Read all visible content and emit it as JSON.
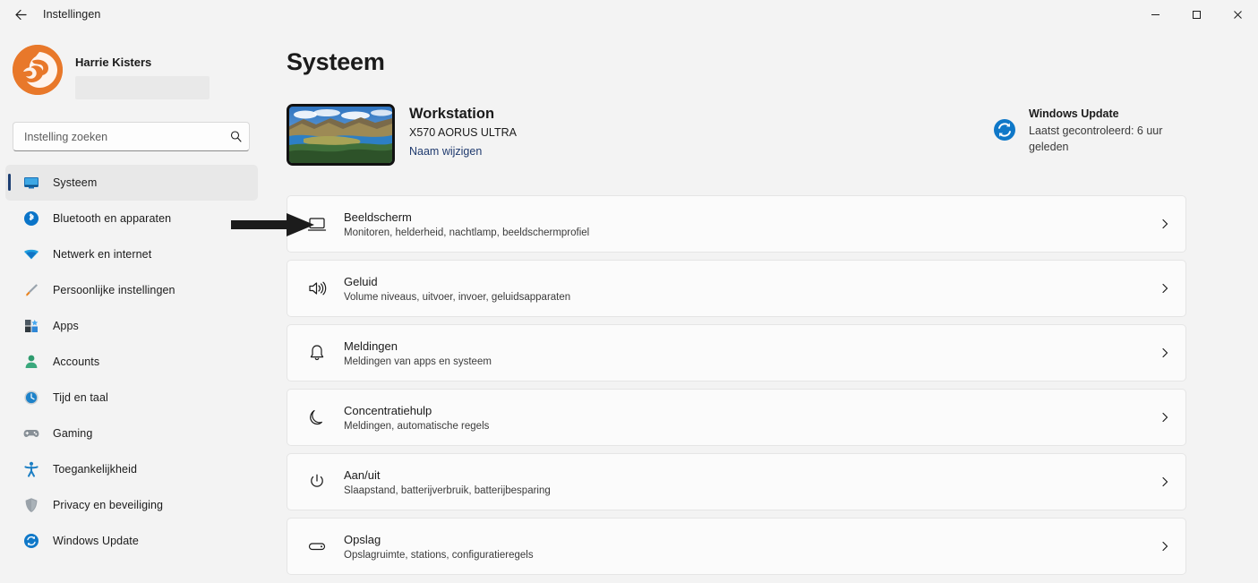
{
  "window": {
    "title": "Instellingen",
    "back_icon": "back-arrow-icon",
    "minimize_label": "−",
    "maximize_label": "□",
    "close_label": "✕"
  },
  "sidebar": {
    "profile": {
      "name": "Harrie Kisters",
      "avatar_icon": "user-avatar-logo",
      "email_redacted": ""
    },
    "search": {
      "placeholder": "Instelling zoeken",
      "value": "",
      "icon": "search-icon"
    },
    "items": [
      {
        "label": "Systeem",
        "icon": "monitor-icon",
        "selected": true
      },
      {
        "label": "Bluetooth en apparaten",
        "icon": "bluetooth-icon",
        "selected": false
      },
      {
        "label": "Netwerk en internet",
        "icon": "wifi-icon",
        "selected": false
      },
      {
        "label": "Persoonlijke instellingen",
        "icon": "paintbrush-icon",
        "selected": false
      },
      {
        "label": "Apps",
        "icon": "apps-grid-icon",
        "selected": false
      },
      {
        "label": "Accounts",
        "icon": "person-icon",
        "selected": false
      },
      {
        "label": "Tijd en taal",
        "icon": "clock-icon",
        "selected": false
      },
      {
        "label": "Gaming",
        "icon": "gamepad-icon",
        "selected": false
      },
      {
        "label": "Toegankelijkheid",
        "icon": "accessibility-icon",
        "selected": false
      },
      {
        "label": "Privacy en beveiliging",
        "icon": "shield-icon",
        "selected": false
      },
      {
        "label": "Windows Update",
        "icon": "sync-icon",
        "selected": false
      }
    ]
  },
  "main": {
    "page_title": "Systeem",
    "device": {
      "name": "Workstation",
      "model": "X570 AORUS ULTRA",
      "rename_link": "Naam wijzigen",
      "thumbnail_icon": "desktop-wallpaper-thumbnail"
    },
    "update_status": {
      "icon": "sync-icon",
      "title": "Windows Update",
      "subtitle": "Laatst gecontroleerd: 6 uur geleden"
    },
    "rows": [
      {
        "title": "Beeldscherm",
        "subtitle": "Monitoren, helderheid, nachtlamp, beeldschermprofiel",
        "icon": "display-icon",
        "chevron": "chevron-right-icon",
        "annotated": true
      },
      {
        "title": "Geluid",
        "subtitle": "Volume niveaus, uitvoer, invoer, geluidsapparaten",
        "icon": "speaker-icon",
        "chevron": "chevron-right-icon",
        "annotated": false
      },
      {
        "title": "Meldingen",
        "subtitle": "Meldingen van apps en systeem",
        "icon": "bell-icon",
        "chevron": "chevron-right-icon",
        "annotated": false
      },
      {
        "title": "Concentratiehulp",
        "subtitle": "Meldingen, automatische regels",
        "icon": "moon-icon",
        "chevron": "chevron-right-icon",
        "annotated": false
      },
      {
        "title": "Aan/uit",
        "subtitle": "Slaapstand, batterijverbruik, batterijbesparing",
        "icon": "power-icon",
        "chevron": "chevron-right-icon",
        "annotated": false
      },
      {
        "title": "Opslag",
        "subtitle": "Opslagruimte, stations, configuratieregels",
        "icon": "storage-icon",
        "chevron": "chevron-right-icon",
        "annotated": false
      }
    ]
  },
  "colors": {
    "accent": "#1d3f73",
    "page_bg": "#f3f3f3",
    "card_bg": "#fbfbfb",
    "link": "#1f3a6e",
    "avatar_orange": "#e8782a"
  }
}
